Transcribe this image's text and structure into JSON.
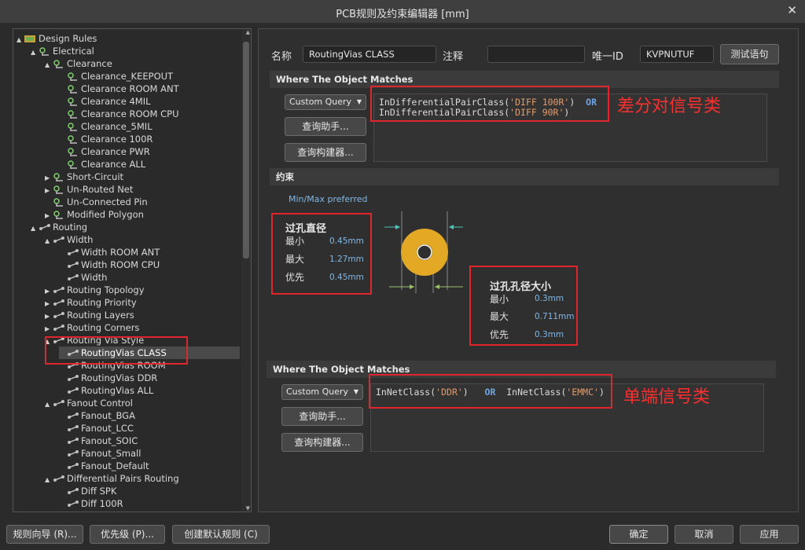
{
  "window": {
    "title": "PCB规则及约束编辑器 [mm]",
    "close_glyph": "✕"
  },
  "tree": {
    "items": [
      {
        "label": "Design Rules",
        "level": 0,
        "toggle": "▲",
        "icon": "rules-root-icon"
      },
      {
        "label": "Electrical",
        "level": 1,
        "toggle": "▲",
        "icon": "rule-category-icon"
      },
      {
        "label": "Clearance",
        "level": 2,
        "toggle": "▲",
        "icon": "rule-category-icon"
      },
      {
        "label": "Clearance_KEEPOUT",
        "level": 3,
        "toggle": "",
        "icon": "rule-icon"
      },
      {
        "label": "Clearance ROOM ANT",
        "level": 3,
        "toggle": "",
        "icon": "rule-icon"
      },
      {
        "label": "Clearance 4MIL",
        "level": 3,
        "toggle": "",
        "icon": "rule-icon"
      },
      {
        "label": "Clearance ROOM CPU",
        "level": 3,
        "toggle": "",
        "icon": "rule-icon"
      },
      {
        "label": "Clearance_5MIL",
        "level": 3,
        "toggle": "",
        "icon": "rule-icon"
      },
      {
        "label": "Clearance 100R",
        "level": 3,
        "toggle": "",
        "icon": "rule-icon"
      },
      {
        "label": "Clearance PWR",
        "level": 3,
        "toggle": "",
        "icon": "rule-icon"
      },
      {
        "label": "Clearance ALL",
        "level": 3,
        "toggle": "",
        "icon": "rule-icon"
      },
      {
        "label": "Short-Circuit",
        "level": 2,
        "toggle": "▶",
        "icon": "rule-category-icon"
      },
      {
        "label": "Un-Routed Net",
        "level": 2,
        "toggle": "▶",
        "icon": "rule-category-icon"
      },
      {
        "label": "Un-Connected Pin",
        "level": 2,
        "toggle": "",
        "icon": "rule-category-icon"
      },
      {
        "label": "Modified Polygon",
        "level": 2,
        "toggle": "▶",
        "icon": "rule-category-icon"
      },
      {
        "label": "Routing",
        "level": 1,
        "toggle": "▲",
        "icon": "routing-category-icon"
      },
      {
        "label": "Width",
        "level": 2,
        "toggle": "▲",
        "icon": "routing-rule-icon"
      },
      {
        "label": "Width ROOM ANT",
        "level": 3,
        "toggle": "",
        "icon": "routing-rule-icon"
      },
      {
        "label": "Width ROOM CPU",
        "level": 3,
        "toggle": "",
        "icon": "routing-rule-icon"
      },
      {
        "label": "Width",
        "level": 3,
        "toggle": "",
        "icon": "routing-rule-icon"
      },
      {
        "label": "Routing Topology",
        "level": 2,
        "toggle": "▶",
        "icon": "routing-rule-icon"
      },
      {
        "label": "Routing Priority",
        "level": 2,
        "toggle": "▶",
        "icon": "routing-rule-icon"
      },
      {
        "label": "Routing Layers",
        "level": 2,
        "toggle": "▶",
        "icon": "routing-rule-icon"
      },
      {
        "label": "Routing Corners",
        "level": 2,
        "toggle": "▶",
        "icon": "routing-rule-icon"
      },
      {
        "label": "Routing Via Style",
        "level": 2,
        "toggle": "▲",
        "icon": "routing-rule-icon"
      },
      {
        "label": "RoutingVias CLASS",
        "level": 3,
        "toggle": "",
        "icon": "routing-rule-icon",
        "selected": true
      },
      {
        "label": "RoutingVias ROOM",
        "level": 3,
        "toggle": "",
        "icon": "routing-rule-icon"
      },
      {
        "label": "RoutingVias DDR",
        "level": 3,
        "toggle": "",
        "icon": "routing-rule-icon"
      },
      {
        "label": "RoutingVias ALL",
        "level": 3,
        "toggle": "",
        "icon": "routing-rule-icon"
      },
      {
        "label": "Fanout Control",
        "level": 2,
        "toggle": "▲",
        "icon": "routing-rule-icon"
      },
      {
        "label": "Fanout_BGA",
        "level": 3,
        "toggle": "",
        "icon": "routing-rule-icon"
      },
      {
        "label": "Fanout_LCC",
        "level": 3,
        "toggle": "",
        "icon": "routing-rule-icon"
      },
      {
        "label": "Fanout_SOIC",
        "level": 3,
        "toggle": "",
        "icon": "routing-rule-icon"
      },
      {
        "label": "Fanout_Small",
        "level": 3,
        "toggle": "",
        "icon": "routing-rule-icon"
      },
      {
        "label": "Fanout_Default",
        "level": 3,
        "toggle": "",
        "icon": "routing-rule-icon"
      },
      {
        "label": "Differential Pairs Routing",
        "level": 2,
        "toggle": "▲",
        "icon": "routing-rule-icon"
      },
      {
        "label": "Diff SPK",
        "level": 3,
        "toggle": "",
        "icon": "routing-rule-icon"
      },
      {
        "label": "Diff 100R",
        "level": 3,
        "toggle": "",
        "icon": "routing-rule-icon"
      }
    ]
  },
  "rule": {
    "name_label": "名称",
    "name_value": "RoutingVias CLASS",
    "comment_label": "注释",
    "comment_value": "",
    "uid_label": "唯一ID",
    "uid_value": "KVPNUTUF",
    "test_button": "测试语句"
  },
  "match1": {
    "header": "Where The Object Matches",
    "dropdown": "Custom Query",
    "helper_button": "查询助手...",
    "builder_button": "查询构建器...",
    "line1_fn": "InDifferentialPairClass(",
    "line1_arg": "'DIFF 100R'",
    "line1_close": ")",
    "op": "OR",
    "line2_fn": "InDifferentialPairClass(",
    "line2_arg": "'DIFF 90R'",
    "line2_close": ")",
    "note": "差分对信号类"
  },
  "constraints": {
    "header": "约束",
    "preferred_label": "Min/Max preferred",
    "via_diameter_title": "过孔直径",
    "min_label": "最小",
    "max_label": "最大",
    "pref_label": "优先",
    "diameter_min": "0.45mm",
    "diameter_max": "1.27mm",
    "diameter_pref": "0.45mm",
    "hole_title": "过孔孔径大小",
    "hole_min": "0.3mm",
    "hole_max": "0.711mm",
    "hole_pref": "0.3mm"
  },
  "match2": {
    "header": "Where The Object Matches",
    "dropdown": "Custom Query",
    "helper_button": "查询助手...",
    "builder_button": "查询构建器...",
    "fn1": "InNetClass(",
    "arg1": "'DDR'",
    "close1": ")",
    "op": "OR",
    "fn2": "InNetClass(",
    "arg2": "'EMMC'",
    "close2": ")",
    "note": "单端信号类"
  },
  "footer": {
    "wizard_button": "规则向导 (R)...",
    "priority_button": "优先级 (P)...",
    "default_button": "创建默认规则 (C)",
    "ok_button": "确定",
    "cancel_button": "取消",
    "apply_button": "应用"
  },
  "colors": {
    "background": "#2b2b2b",
    "highlight_red": "#e0262c",
    "via_copper": "#e3a824",
    "value_blue": "#80b8e6",
    "query_string": "#e59a69",
    "query_operator": "#6fa7e6"
  }
}
